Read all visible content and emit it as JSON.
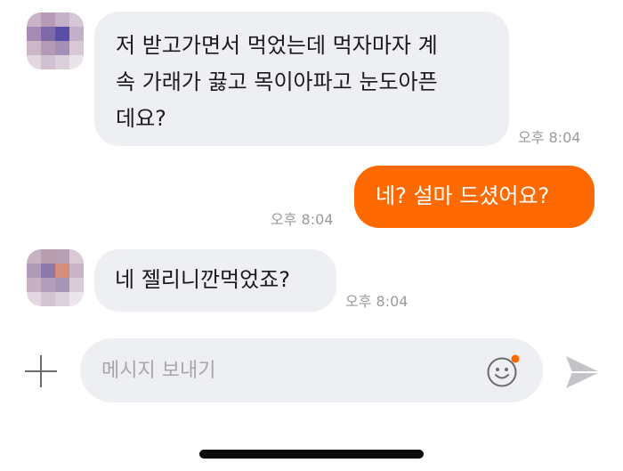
{
  "messages": [
    {
      "side": "incoming",
      "lines": [
        "저 받고가면서 먹었는데 먹자마자 계",
        "속 가래가 끓고 목이아파고 눈도아픈",
        "데요?"
      ],
      "time": "오후 8:04"
    },
    {
      "side": "outgoing",
      "lines": [
        "네? 설마 드셨어요?"
      ],
      "time": "오후 8:04"
    },
    {
      "side": "incoming",
      "lines": [
        "네 젤리니깐먹었죠?"
      ],
      "time": "오후 8:04"
    }
  ],
  "composer": {
    "placeholder": "메시지 보내기",
    "plus_icon": "plus-icon",
    "emoji_icon": "smiley-icon",
    "send_icon": "send-icon"
  },
  "colors": {
    "outgoing_bubble": "#ff6a00",
    "incoming_bubble": "#eeeff2",
    "timestamp": "#9a9a9a",
    "emoji_badge": "#ff6a00"
  }
}
